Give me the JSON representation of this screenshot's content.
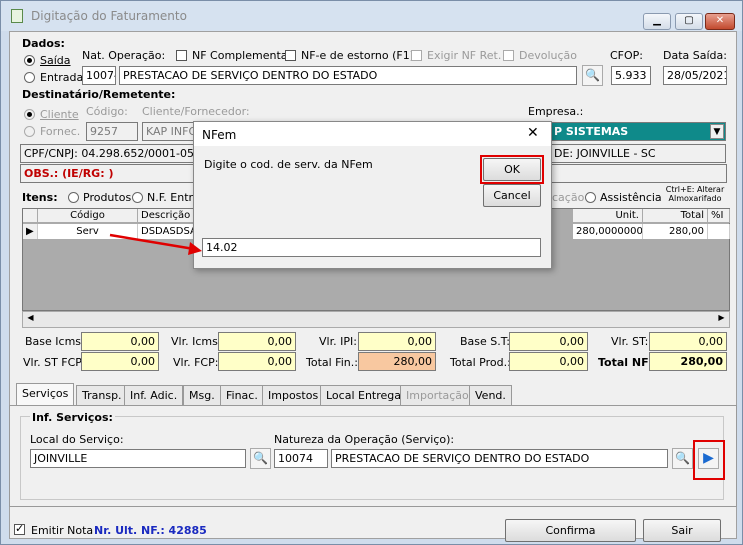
{
  "window": {
    "title": "Digitação do Faturamento",
    "buttons": [
      "▭",
      "▢",
      "✕"
    ]
  },
  "dados": {
    "section_label": "Dados:",
    "saida_label": "Saída",
    "entrada_label": "Entrada",
    "nat_operacao_label": "Nat. Operação:",
    "nf_complementar_label": "NF Complementar",
    "nf_estorno_label": "NF-e de estorno (F1)",
    "exigir_nf_ret_label": "Exigir NF Ret.",
    "devolucao_label": "Devolução",
    "cfop_label": "CFOP:",
    "data_saida_label": "Data Saída:",
    "nat_code": "10074",
    "nat_desc": "PRESTACAO DE SERVIÇO DENTRO DO ESTADO",
    "cfop": "5.933",
    "data_saida": "28/05/2021"
  },
  "destinatario": {
    "section_label": "Destinatário/Remetente:",
    "cliente_label": "Cliente",
    "fornec_label": "Fornec.",
    "codigo_label": "Código:",
    "cliente_fornecedor_label": "Cliente/Fornecedor:",
    "empresa_label": "Empresa.:",
    "codigo": "9257",
    "nome": "KAP INFO",
    "empresa": "P SISTEMAS",
    "cpf_cnpj": "CPF/CNPJ: 04.298.652/0001-05",
    "cidade": "DE: JOINVILLE - SC",
    "obs": "OBS.: (IE/RG: )"
  },
  "itens": {
    "section_label": "Itens:",
    "produtos_label": "Produtos",
    "nf_entrada_label": "N.F. Entra",
    "cacao_label": "cação",
    "assistencia_label": "Assistência",
    "hint": "Ctrl+E: Alterar Almoxarifado",
    "columns": [
      "Código",
      "Descrição",
      "Unit.",
      "Total",
      "%I"
    ],
    "row": {
      "codigo": "Serv",
      "descricao": "DSDASDSA",
      "unit": "280,0000000",
      "total": "280,00"
    }
  },
  "totais": {
    "base_icms_label": "Base Icms:",
    "base_icms": "0,00",
    "vlr_icms_label": "Vlr. Icms:",
    "vlr_icms": "0,00",
    "vlr_ipi_label": "Vlr. IPI:",
    "vlr_ipi": "0,00",
    "base_st_label": "Base S.T:",
    "base_st": "0,00",
    "vlr_st_label": "Vlr. ST:",
    "vlr_st": "0,00",
    "vlr_st_fcp_label": "Vlr. ST FCP:",
    "vlr_st_fcp": "0,00",
    "vlr_fcp_label": "Vlr. FCP:",
    "vlr_fcp": "0,00",
    "total_fin_label": "Total Fin.:",
    "total_fin": "280,00",
    "total_prod_label": "Total Prod.:",
    "total_prod": "0,00",
    "total_nf_label": "Total NF:",
    "total_nf": "280,00"
  },
  "tabs": [
    {
      "label": "Serviços"
    },
    {
      "label": "Transp."
    },
    {
      "label": "Inf. Adic."
    },
    {
      "label": "Msg."
    },
    {
      "label": "Finac."
    },
    {
      "label": "Impostos"
    },
    {
      "label": "Local Entrega"
    },
    {
      "label": "Importação"
    },
    {
      "label": "Vend."
    }
  ],
  "servicos": {
    "group_label": "Inf. Serviços:",
    "local_label": "Local do Serviço:",
    "local_value": "JOINVILLE",
    "natureza_label": "Natureza da Operação (Serviço):",
    "natureza_code": "10074",
    "natureza_desc": "PRESTACAO DE SERVIÇO DENTRO DO ESTADO"
  },
  "footer": {
    "emitir_label": "Emitir Nota",
    "nr_ult_nf": "Nr. Ult. NF.: 42885",
    "confirma_label": "Confirma",
    "sair_label": "Sair"
  },
  "dialog": {
    "title": "NFem",
    "prompt": "Digite o cod. de serv. da NFem",
    "ok_label": "OK",
    "cancel_label": "Cancel",
    "input_value": "14.02"
  },
  "colors": {
    "accent_red": "#e00000",
    "empresa_bg": "#0f8a8a",
    "obs_red": "#c00000"
  }
}
